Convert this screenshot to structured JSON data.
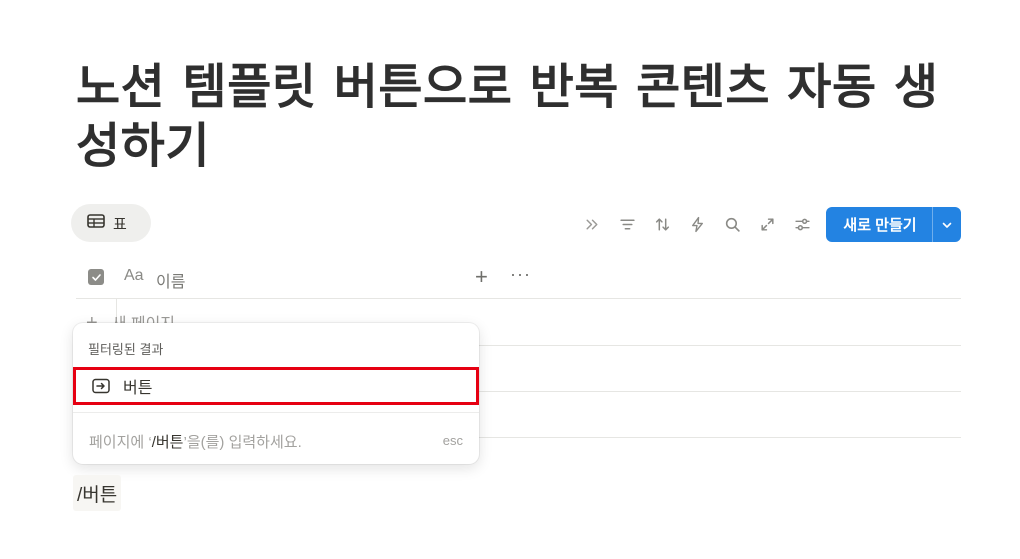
{
  "page": {
    "title": "노션 템플릿 버튼으로 반복 콘텐츠 자동 생성하기"
  },
  "view_tab": {
    "label": "표",
    "icon": "table-icon"
  },
  "toolbar": {
    "icons": [
      "chevrons-right-icon",
      "filter-icon",
      "sort-icon",
      "lightning-icon",
      "search-icon",
      "expand-icon",
      "settings-sliders-icon"
    ],
    "new_button_label": "새로 만들기",
    "accent_color": "#2383e2"
  },
  "table": {
    "header": {
      "type_icon_text": "Aa",
      "column_name": "이름",
      "add_label": "+",
      "more_label": "···"
    },
    "new_page_label": "새 페이지"
  },
  "popup": {
    "heading": "필터링된 결과",
    "item_label": "버튼",
    "hint_prefix": "페이지에 ‘",
    "hint_command": "/버튼",
    "hint_suffix": "’을(를) 입력하세요.",
    "esc_label": "esc",
    "highlight_color": "#e60012"
  },
  "slash_command": "/버튼"
}
